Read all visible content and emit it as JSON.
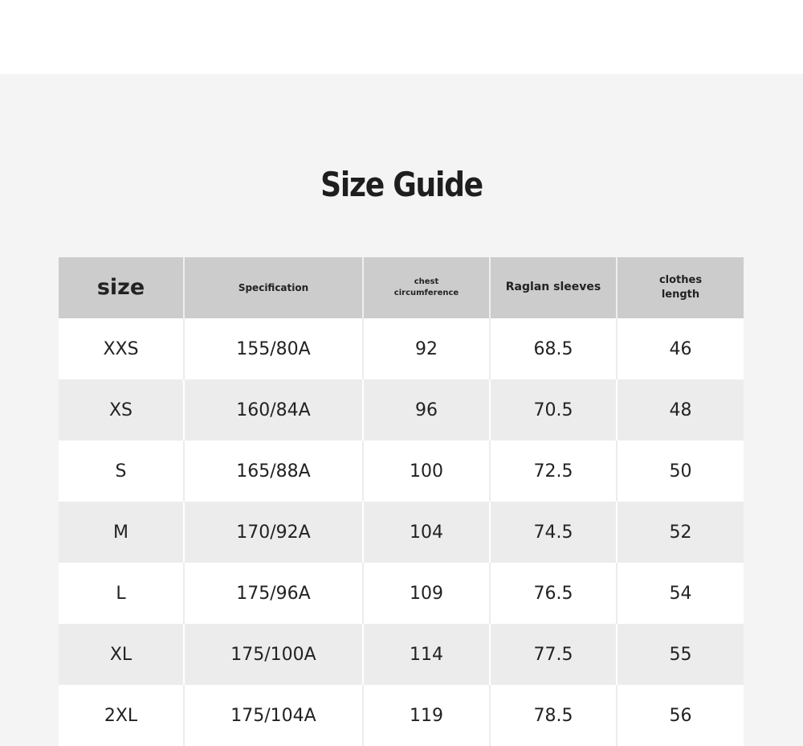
{
  "title": "Size Guide",
  "table": {
    "headers": {
      "size": "size",
      "specification": "Specification",
      "chest_line1": "chest",
      "chest_line2": "circumference",
      "raglan": "Raglan sleeves",
      "length_line1": "clothes",
      "length_line2": "length"
    },
    "rows": [
      {
        "size": "XXS",
        "specification": "155/80A",
        "chest": "92",
        "raglan": "68.5",
        "length": "46"
      },
      {
        "size": "XS",
        "specification": "160/84A",
        "chest": "96",
        "raglan": "70.5",
        "length": "48"
      },
      {
        "size": "S",
        "specification": "165/88A",
        "chest": "100",
        "raglan": "72.5",
        "length": "50"
      },
      {
        "size": "M",
        "specification": "170/92A",
        "chest": "104",
        "raglan": "74.5",
        "length": "52"
      },
      {
        "size": "L",
        "specification": "175/96A",
        "chest": "109",
        "raglan": "76.5",
        "length": "54"
      },
      {
        "size": "XL",
        "specification": "175/100A",
        "chest": "114",
        "raglan": "77.5",
        "length": "55"
      },
      {
        "size": "2XL",
        "specification": "175/104A",
        "chest": "119",
        "raglan": "78.5",
        "length": "56"
      }
    ]
  },
  "colors": {
    "header_bg": "#cccccc",
    "row_alt_bg": "#ececec",
    "panel_bg": "#f4f4f4",
    "text": "#222222"
  }
}
